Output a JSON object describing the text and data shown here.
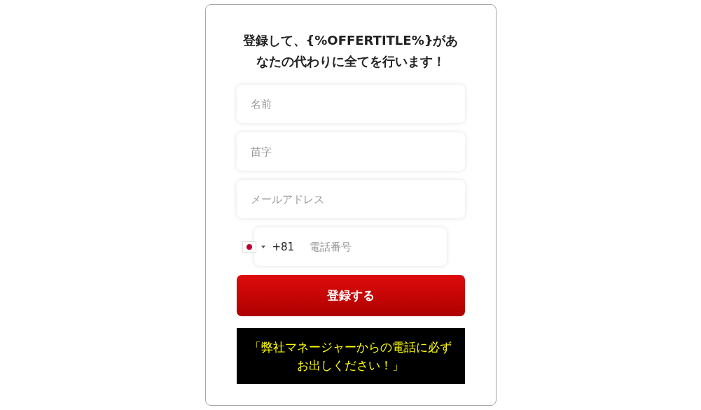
{
  "form": {
    "title": "登録して、{%OFFERTITLE%}があなたの代わりに全てを行います！",
    "fields": [
      {
        "placeholder": "名前"
      },
      {
        "placeholder": "苗字"
      },
      {
        "placeholder": "メールアドレス"
      }
    ],
    "phone": {
      "dial_code": "+81",
      "placeholder": "電話番号"
    },
    "submit": "登録する",
    "notice": "「弊社マネージャーからの電話に必ずお出しください！」"
  }
}
